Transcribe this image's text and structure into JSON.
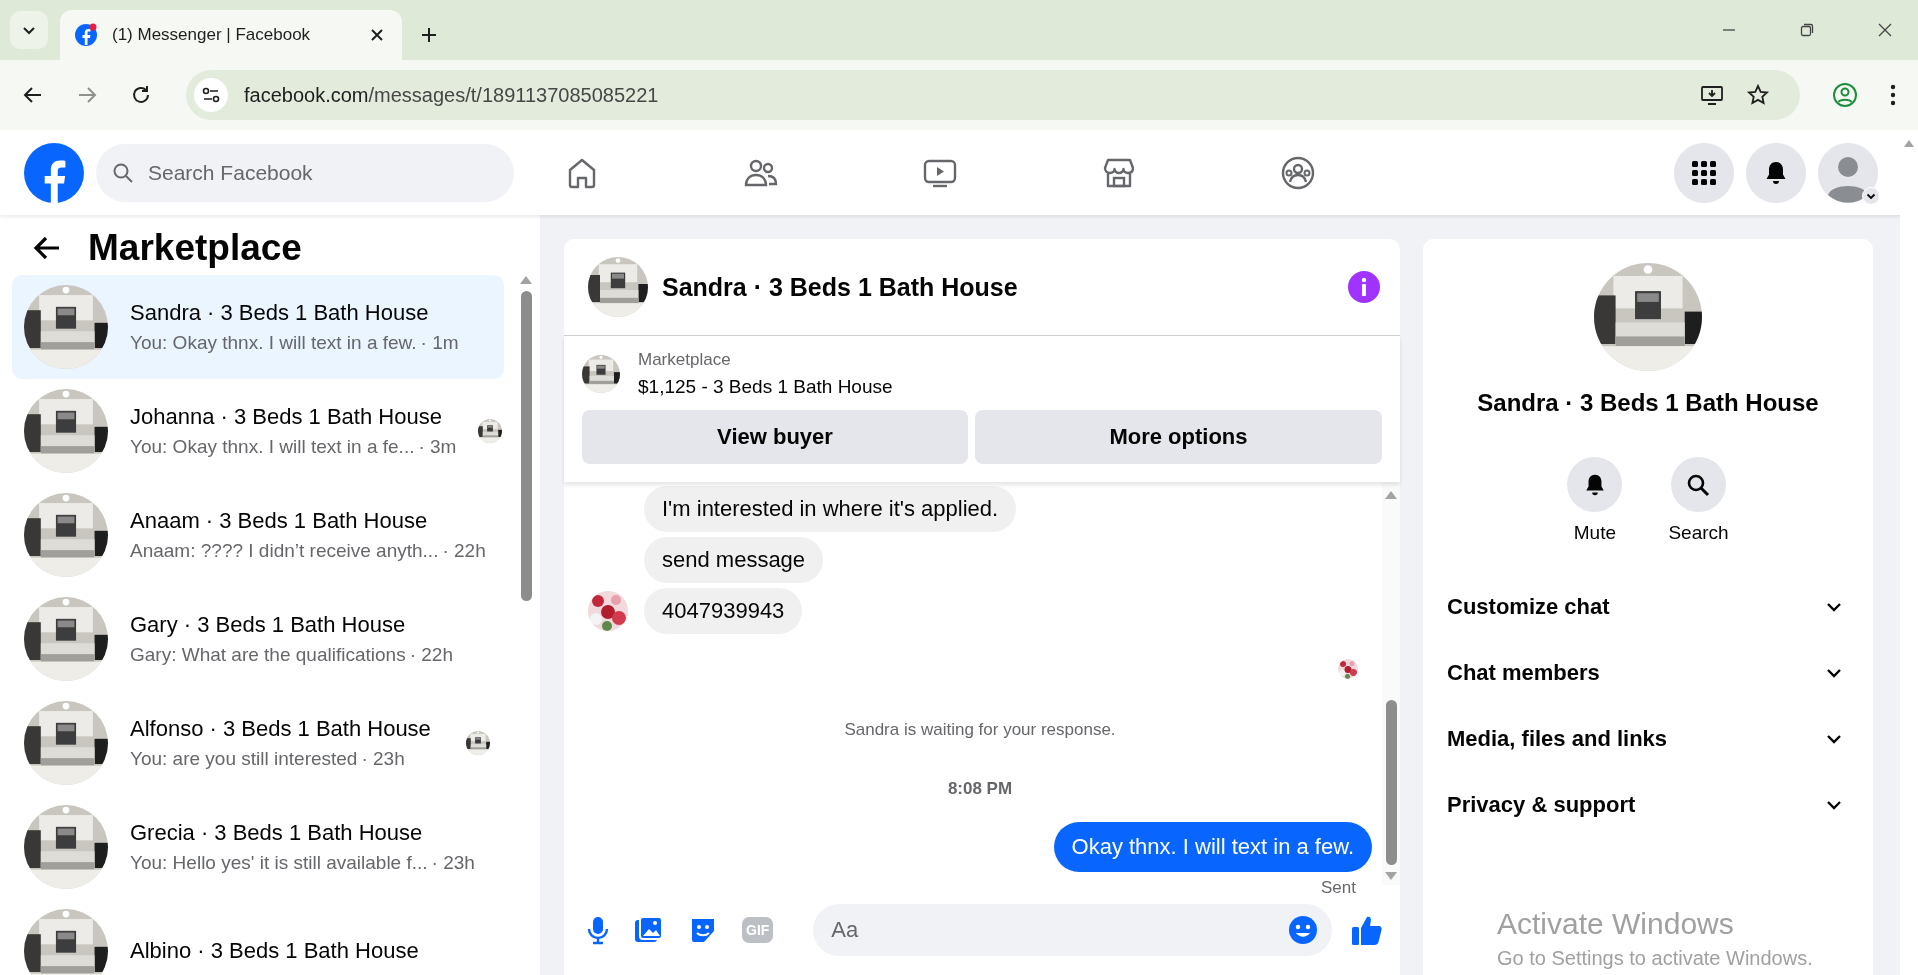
{
  "browser": {
    "tab_title": "(1) Messenger | Facebook",
    "url_domain": "facebook.com",
    "url_path": "/messages/t/1891137085085221"
  },
  "header": {
    "search_placeholder": "Search Facebook"
  },
  "sidebar": {
    "title": "Marketplace",
    "conversations": [
      {
        "name": "Sandra · 3 Beds 1 Bath House",
        "preview": "You: Okay thnx. I will text in a few.",
        "time": "· 1m",
        "selected": true,
        "read_receipt": false
      },
      {
        "name": "Johanna · 3 Beds 1 Bath House",
        "preview": "You: Okay thnx. I will text in a fe...",
        "time": "· 3m",
        "selected": false,
        "read_receipt": true
      },
      {
        "name": "Anaam · 3 Beds 1 Bath House",
        "preview": "Anaam: ???? I didn’t receive anyth...",
        "time": "· 22h",
        "selected": false,
        "read_receipt": false
      },
      {
        "name": "Gary · 3 Beds 1 Bath House",
        "preview": "Gary: What are the qualifications",
        "time": "· 22h",
        "selected": false,
        "read_receipt": false
      },
      {
        "name": "Alfonso · 3 Beds 1 Bath House",
        "preview": "You: are you still interested",
        "time": "· 23h",
        "selected": false,
        "read_receipt": true
      },
      {
        "name": "Grecia · 3 Beds 1 Bath House",
        "preview": "You: Hello yes' it is still available f...",
        "time": "· 23h",
        "selected": false,
        "read_receipt": false
      },
      {
        "name": "Albino · 3 Beds 1 Bath House",
        "selected": false,
        "read_receipt": false
      }
    ]
  },
  "chat": {
    "title": "Sandra · 3 Beds 1 Bath House",
    "listing": {
      "label": "Marketplace",
      "title": "$1,125 - 3 Beds 1 Bath House"
    },
    "buttons": [
      "View buyer",
      "More options"
    ],
    "messages": [
      {
        "kind": "incoming",
        "text": "I'm interested in where it's applied.",
        "avatar": false
      },
      {
        "kind": "incoming",
        "text": "send message",
        "avatar": false
      },
      {
        "kind": "incoming",
        "text": "4047939943",
        "avatar": true
      },
      {
        "kind": "seen"
      },
      {
        "kind": "notice",
        "text": "Sandra is waiting for your response."
      },
      {
        "kind": "time",
        "text": "8:08 PM"
      },
      {
        "kind": "outgoing",
        "text": "Okay thnx. I will text in a few.",
        "status": "Sent"
      }
    ],
    "composer": {
      "placeholder": "Aa",
      "gif_label": "GIF"
    }
  },
  "details": {
    "title": "Sandra · 3 Beds 1 Bath House",
    "actions": [
      {
        "kind": "mute",
        "label": "Mute"
      },
      {
        "kind": "search",
        "label": "Search"
      }
    ],
    "sections": [
      {
        "label": "Customize chat",
        "expanded": false
      },
      {
        "label": "Chat members",
        "expanded": false
      },
      {
        "label": "Media, files and links",
        "expanded": false
      },
      {
        "label": "Privacy & support",
        "expanded": false
      }
    ]
  },
  "os_overlay": {
    "title": "Activate Windows",
    "text": "Go to Settings to activate Windows."
  }
}
